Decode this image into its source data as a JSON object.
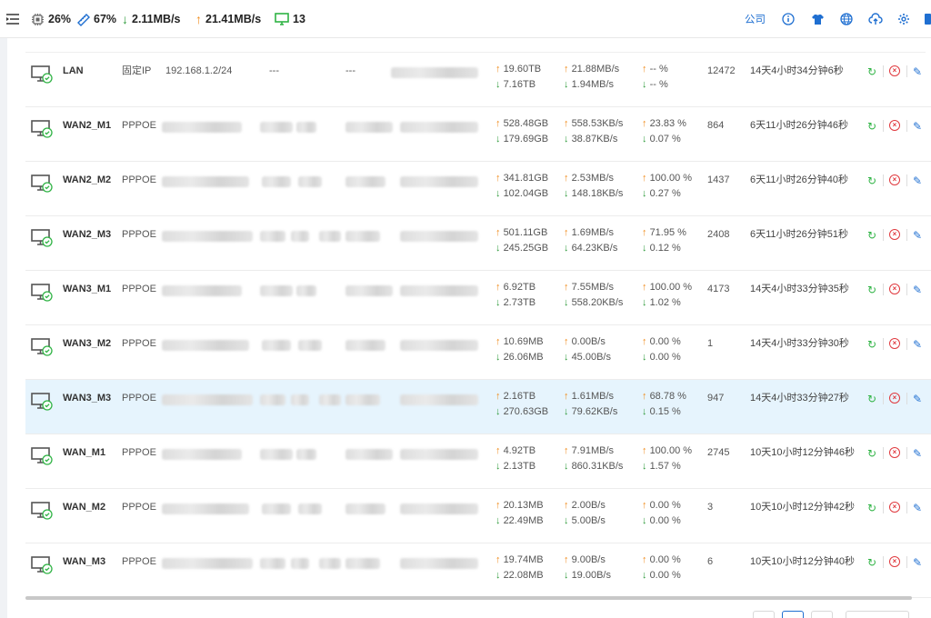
{
  "topbar": {
    "cpu": "26%",
    "mem": "67%",
    "down_speed": "2.11MB/s",
    "up_speed": "21.41MB/s",
    "online_count": "13",
    "company_label": "公司"
  },
  "rows": [
    {
      "name": "LAN",
      "type": "固定IP",
      "ip": "192.168.1.2/24",
      "d1": "---",
      "d2": "---",
      "tx_total": "19.60TB",
      "rx_total": "7.16TB",
      "tx_rate": "21.88MB/s",
      "rx_rate": "1.94MB/s",
      "tx_pct": "-- %",
      "rx_pct": "-- %",
      "conns": "12472",
      "uptime": "14天4小时34分钟6秒"
    },
    {
      "name": "WAN2_M1",
      "type": "PPPOE",
      "ip": "",
      "d1": "",
      "d2": "",
      "tx_total": "528.48GB",
      "rx_total": "179.69GB",
      "tx_rate": "558.53KB/s",
      "rx_rate": "38.87KB/s",
      "tx_pct": "23.83 %",
      "rx_pct": "0.07 %",
      "conns": "864",
      "uptime": "6天11小时26分钟46秒"
    },
    {
      "name": "WAN2_M2",
      "type": "PPPOE",
      "ip": "",
      "d1": "",
      "d2": "",
      "tx_total": "341.81GB",
      "rx_total": "102.04GB",
      "tx_rate": "2.53MB/s",
      "rx_rate": "148.18KB/s",
      "tx_pct": "100.00 %",
      "rx_pct": "0.27 %",
      "conns": "1437",
      "uptime": "6天11小时26分钟40秒"
    },
    {
      "name": "WAN2_M3",
      "type": "PPPOE",
      "ip": "",
      "d1": "",
      "d2": "",
      "tx_total": "501.11GB",
      "rx_total": "245.25GB",
      "tx_rate": "1.69MB/s",
      "rx_rate": "64.23KB/s",
      "tx_pct": "71.95 %",
      "rx_pct": "0.12 %",
      "conns": "2408",
      "uptime": "6天11小时26分钟51秒"
    },
    {
      "name": "WAN3_M1",
      "type": "PPPOE",
      "ip": "",
      "d1": "",
      "d2": "",
      "tx_total": "6.92TB",
      "rx_total": "2.73TB",
      "tx_rate": "7.55MB/s",
      "rx_rate": "558.20KB/s",
      "tx_pct": "100.00 %",
      "rx_pct": "1.02 %",
      "conns": "4173",
      "uptime": "14天4小时33分钟35秒"
    },
    {
      "name": "WAN3_M2",
      "type": "PPPOE",
      "ip": "",
      "d1": "",
      "d2": "",
      "tx_total": "10.69MB",
      "rx_total": "26.06MB",
      "tx_rate": "0.00B/s",
      "rx_rate": "45.00B/s",
      "tx_pct": "0.00 %",
      "rx_pct": "0.00 %",
      "conns": "1",
      "uptime": "14天4小时33分钟30秒"
    },
    {
      "name": "WAN3_M3",
      "type": "PPPOE",
      "ip": "",
      "d1": "",
      "d2": "",
      "tx_total": "2.16TB",
      "rx_total": "270.63GB",
      "tx_rate": "1.61MB/s",
      "rx_rate": "79.62KB/s",
      "tx_pct": "68.78 %",
      "rx_pct": "0.15 %",
      "conns": "947",
      "uptime": "14天4小时33分钟27秒",
      "highlight": true
    },
    {
      "name": "WAN_M1",
      "type": "PPPOE",
      "ip": "",
      "d1": "",
      "d2": "",
      "tx_total": "4.92TB",
      "rx_total": "2.13TB",
      "tx_rate": "7.91MB/s",
      "rx_rate": "860.31KB/s",
      "tx_pct": "100.00 %",
      "rx_pct": "1.57 %",
      "conns": "2745",
      "uptime": "10天10小时12分钟46秒"
    },
    {
      "name": "WAN_M2",
      "type": "PPPOE",
      "ip": "",
      "d1": "",
      "d2": "",
      "tx_total": "20.13MB",
      "rx_total": "22.49MB",
      "tx_rate": "2.00B/s",
      "rx_rate": "5.00B/s",
      "tx_pct": "0.00 %",
      "rx_pct": "0.00 %",
      "conns": "3",
      "uptime": "10天10小时12分钟42秒"
    },
    {
      "name": "WAN_M3",
      "type": "PPPOE",
      "ip": "",
      "d1": "",
      "d2": "",
      "tx_total": "19.74MB",
      "rx_total": "22.08MB",
      "tx_rate": "9.00B/s",
      "rx_rate": "19.00B/s",
      "tx_pct": "0.00 %",
      "rx_pct": "0.00 %",
      "conns": "6",
      "uptime": "10天10小时12分钟40秒"
    }
  ],
  "colors": {
    "accent": "#1f6fd1",
    "up": "#f08c1c",
    "down": "#2f9b3c",
    "ok": "#2fb344",
    "danger": "#e0393e",
    "highlight_row": "#e6f4fd"
  }
}
